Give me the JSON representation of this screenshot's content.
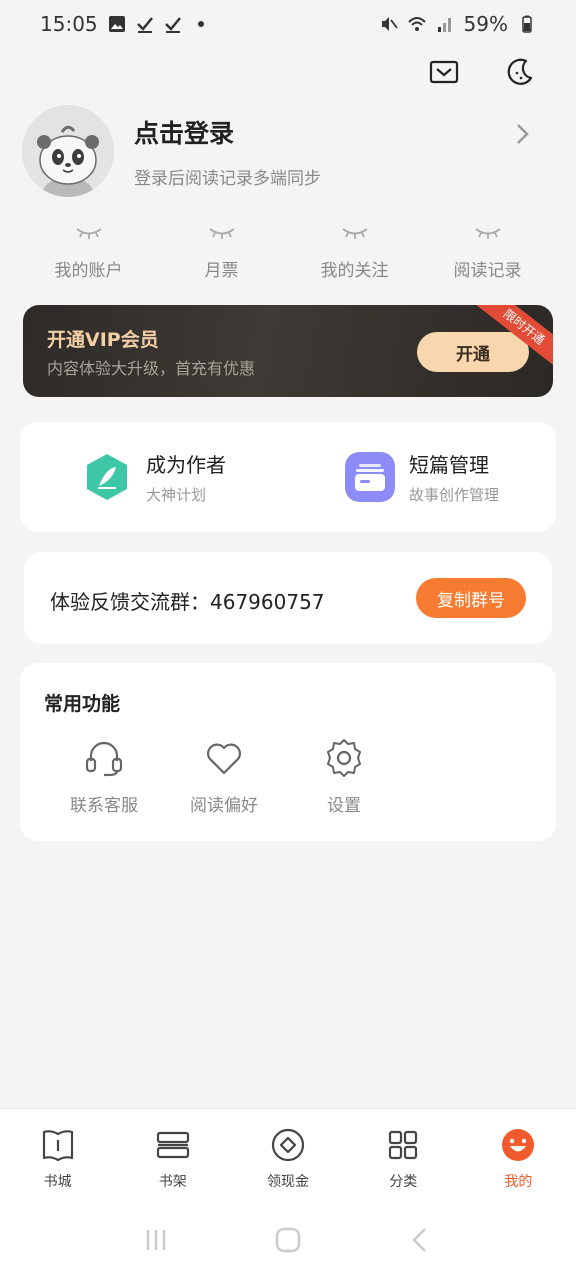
{
  "status_bar": {
    "time": "15:05",
    "battery": "59%",
    "left_icons": [
      "image-icon",
      "check-icon",
      "check-icon",
      "dot-icon"
    ],
    "right_icons": [
      "mute-icon",
      "wifi-icon",
      "signal-icon",
      "battery-icon"
    ]
  },
  "top_icons": [
    "mail-icon",
    "night-mode-icon"
  ],
  "profile": {
    "title": "点击登录",
    "subtitle": "登录后阅读记录多端同步"
  },
  "stats": [
    {
      "label": "我的账户"
    },
    {
      "label": "月票"
    },
    {
      "label": "我的关注"
    },
    {
      "label": "阅读记录"
    }
  ],
  "vip": {
    "title": "开通VIP会员",
    "subtitle": "内容体验大升级，首充有优惠",
    "button": "开通",
    "ribbon": "限时开通"
  },
  "features": [
    {
      "title": "成为作者",
      "subtitle": "大神计划",
      "icon": "feather-icon",
      "color": "#3ec7a6"
    },
    {
      "title": "短篇管理",
      "subtitle": "故事创作管理",
      "icon": "cards-icon",
      "color": "#8d8cf6"
    }
  ],
  "feedback": {
    "text": "体验反馈交流群：467960757",
    "button": "复制群号"
  },
  "common": {
    "title": "常用功能",
    "items": [
      {
        "label": "联系客服",
        "icon": "headset-icon"
      },
      {
        "label": "阅读偏好",
        "icon": "heart-icon"
      },
      {
        "label": "设置",
        "icon": "gear-icon"
      }
    ]
  },
  "bottom_nav": [
    {
      "label": "书城",
      "icon": "book-icon"
    },
    {
      "label": "书架",
      "icon": "shelf-icon"
    },
    {
      "label": "领现金",
      "icon": "coin-icon"
    },
    {
      "label": "分类",
      "icon": "grid-icon"
    },
    {
      "label": "我的",
      "icon": "smile-icon",
      "active": true
    }
  ],
  "colors": {
    "accent": "#f77c32",
    "active_nav": "#f05a2c",
    "vip_gold": "#f3cfa5"
  }
}
